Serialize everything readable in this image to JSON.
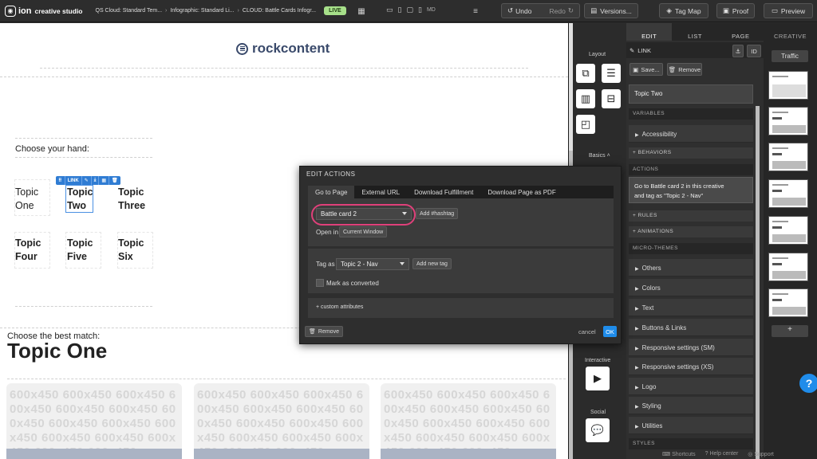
{
  "topbar": {
    "logo_mark": "ion",
    "logo_sub": "creative studio",
    "crumbs": [
      "QS Cloud: Standard Tem...",
      "Infographic: Standard Li...",
      "CLOUD: Battle Cards Infogr..."
    ],
    "live_badge": "LIVE",
    "device_size": "MD",
    "undo_label": "Undo",
    "redo_label": "Redo",
    "versions_label": "Versions...",
    "tagmap_label": "Tag Map",
    "proof_label": "Proof",
    "preview_label": "Preview"
  },
  "canvas": {
    "brand": "rockcontent",
    "choose_hand": "Choose your hand:",
    "topics": [
      {
        "l1": "Topic",
        "l2": "One"
      },
      {
        "l1": "Topic",
        "l2": "Two"
      },
      {
        "l1": "Topic",
        "l2": "Three"
      },
      {
        "l1": "Topic",
        "l2": "Four"
      },
      {
        "l1": "Topic",
        "l2": "Five"
      },
      {
        "l1": "Topic",
        "l2": "Six"
      }
    ],
    "link_tag": "LINK",
    "choose_match": "Choose the best match:",
    "big_title": "Topic One",
    "placeholder": "600x450 600x450 600x450 600x450 600x450 600x450 600x450 600x450 600x450 600x450 600x450 600x450 600x450 600x450 600x450"
  },
  "rail": {
    "layout": "Layout",
    "basics": "Basics",
    "interactive": "Interactive",
    "social": "Social"
  },
  "props": {
    "tabs": [
      "EDIT",
      "LIST",
      "PAGE"
    ],
    "link_label": "LINK",
    "id_label": "ID",
    "save_label": "Save...",
    "remove_label": "Remove",
    "element_name": "Topic Two",
    "variables": "VARIABLES",
    "accessibility": "Accessibility",
    "behaviors": "+ BEHAVIORS",
    "actions": "ACTIONS",
    "action_desc_1": "Go to Battle card 2 in this creative",
    "action_desc_2": "and tag as \"Topic 2 - Nav\"",
    "rules": "+ RULES",
    "animations": "+ ANIMATIONS",
    "micro_themes": "MICRO-THEMES",
    "items": [
      "Others",
      "Colors",
      "Text",
      "Buttons & Links",
      "Responsive settings (SM)",
      "Responsive settings (XS)",
      "Logo",
      "Styling",
      "Utilities"
    ],
    "styles": "STYLES"
  },
  "creative": {
    "header": "CREATIVE",
    "traffic": "Traffic",
    "add": "+"
  },
  "modal": {
    "title": "EDIT ACTIONS",
    "tabs": [
      "Go to Page",
      "External URL",
      "Download Fulfillment",
      "Download Page as PDF"
    ],
    "page_select": "Battle card 2",
    "add_hashtag": "Add #hashtag",
    "open_in": "Open in",
    "open_in_value": "Current Window",
    "tag_as": "Tag as",
    "tag_value": "Topic 2 - Nav",
    "add_tag": "Add new tag",
    "mark_converted": "Mark as converted",
    "custom_attrs": "+ custom attributes",
    "remove": "Remove",
    "cancel": "cancel",
    "ok": "OK"
  },
  "footer": {
    "shortcuts": "Shortcuts",
    "help_center": "Help center",
    "support": "Support"
  },
  "help_button": "?"
}
